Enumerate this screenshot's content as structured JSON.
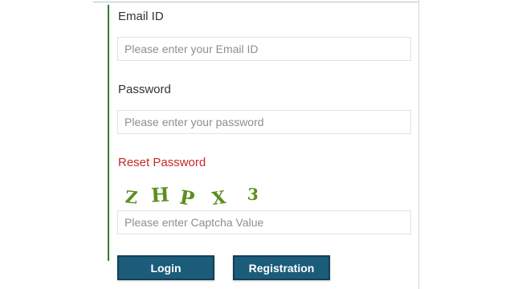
{
  "form": {
    "email_label": "Email ID",
    "email_placeholder": "Please enter your Email ID",
    "password_label": "Password",
    "password_placeholder": "Please enter your password",
    "reset_password_link": "Reset Password",
    "captcha_chars": [
      "Z",
      "H",
      "P",
      "X",
      "3"
    ],
    "captcha_placeholder": "Please enter Captcha Value",
    "login_button": "Login",
    "registration_button": "Registration"
  },
  "colors": {
    "accent_green": "#2e7d32",
    "link_red": "#c62828",
    "button_blue": "#1c5c7b",
    "captcha_green": "#5b8f1f"
  }
}
